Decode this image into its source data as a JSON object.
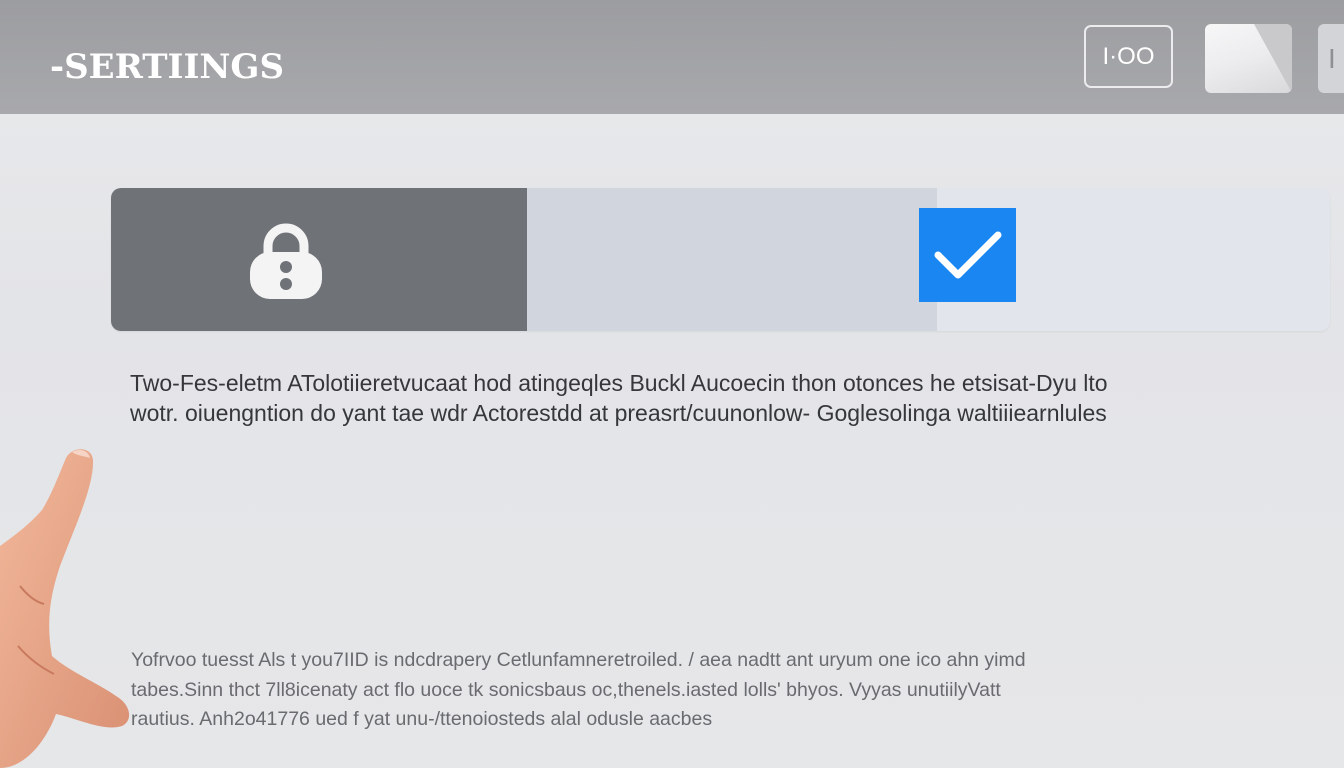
{
  "header": {
    "title": "-SERTIINGS",
    "time_label": "I·OO",
    "edge_label": "I"
  },
  "security": {
    "lock_icon": "lock-icon",
    "checkbox_icon": "check-icon",
    "checkbox_checked": true
  },
  "description": {
    "lines": [
      "Two-Fes-eletm ATolotiieretvucaat hod atingeqles Buckl Aucoecin thon otonces he etsisat-Dyu lto",
      "wotr. oiuengntion do yant tae wdr Actorestdd at preasrt/cuunonlow- Goglesolinga waltiiiearnlules"
    ]
  },
  "footer": {
    "lines": [
      "Yofrvoo tuesst Als t you7IID is ndcdrapery Cetlunfamneretroiled. / aea nadtt ant uryum one ico ahn yimd",
      "tabes.Sinn thct 7ll8icenaty act flo uoce tk sonicsbaus oc,thenels.iasted lolls' bhyos. Vyyas unutiilyVatt",
      "rautius. Anh2o41776 ued f yat unu-/ttenoiosteds alal odusle aacbes"
    ]
  },
  "colors": {
    "header_bg": "#a3a4a7",
    "lock_pane": "#6f7276",
    "checkbox": "#1a86f2",
    "page_bg": "#e6e7e9"
  }
}
